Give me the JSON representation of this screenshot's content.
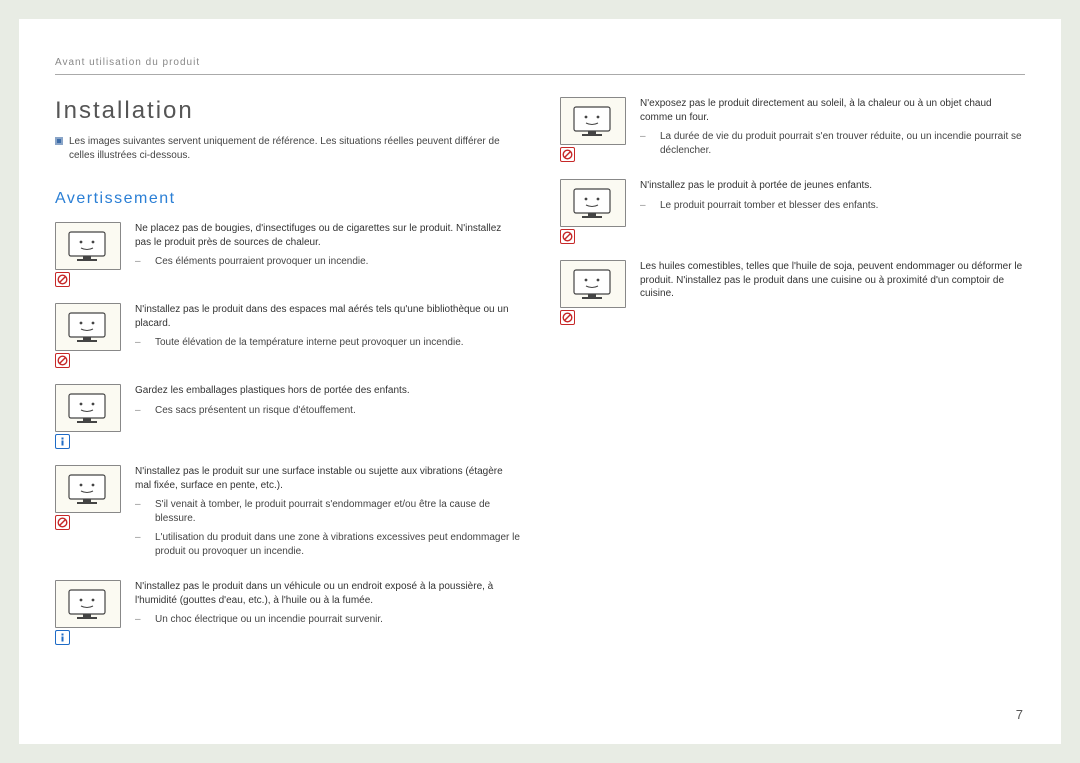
{
  "header": "Avant utilisation du produit",
  "title": "Installation",
  "note_text": "Les images suivantes servent uniquement de référence. Les situations réelles peuvent différer de celles illustrées ci-dessous.",
  "section_heading": "Avertissement",
  "page_number": "7",
  "left_items": [
    {
      "badge": "prohibit",
      "main": "Ne placez pas de bougies, d'insectifuges ou de cigarettes sur le produit. N'installez pas le produit près de sources de chaleur.",
      "subs": [
        "Ces éléments pourraient provoquer un incendie."
      ]
    },
    {
      "badge": "prohibit",
      "main": "N'installez pas le produit dans des espaces mal aérés tels qu'une bibliothèque ou un placard.",
      "subs": [
        "Toute élévation de la température interne peut provoquer un incendie."
      ]
    },
    {
      "badge": "info",
      "main": "Gardez les emballages plastiques hors de portée des enfants.",
      "subs": [
        "Ces sacs présentent un risque d'étouffement."
      ]
    },
    {
      "badge": "prohibit",
      "main": "N'installez pas le produit sur une surface instable ou sujette aux vibrations (étagère mal fixée, surface en pente, etc.).",
      "subs": [
        "S'il venait à tomber, le produit pourrait s'endommager et/ou être la cause de blessure.",
        "L'utilisation du produit dans une zone à vibrations excessives peut endommager le produit ou provoquer un incendie."
      ]
    },
    {
      "badge": "info",
      "main": "N'installez pas le produit dans un véhicule ou un endroit exposé à la poussière, à l'humidité (gouttes d'eau, etc.), à l'huile ou à la fumée.",
      "subs": [
        "Un choc électrique ou un incendie pourrait survenir."
      ]
    }
  ],
  "right_items": [
    {
      "badge": "prohibit",
      "main": "N'exposez pas le produit directement au soleil, à la chaleur ou à un objet chaud comme un four.",
      "subs": [
        "La durée de vie du produit pourrait s'en trouver réduite, ou un incendie pourrait se déclencher."
      ]
    },
    {
      "badge": "prohibit",
      "main": "N'installez pas le produit à portée de jeunes enfants.",
      "subs": [
        "Le produit pourrait tomber et blesser des enfants."
      ]
    },
    {
      "badge": "prohibit",
      "main": "Les huiles comestibles, telles que l'huile de soja, peuvent endommager ou déformer le produit. N'installez pas le produit dans une cuisine ou à proximité d'un comptoir de cuisine.",
      "subs": []
    }
  ]
}
